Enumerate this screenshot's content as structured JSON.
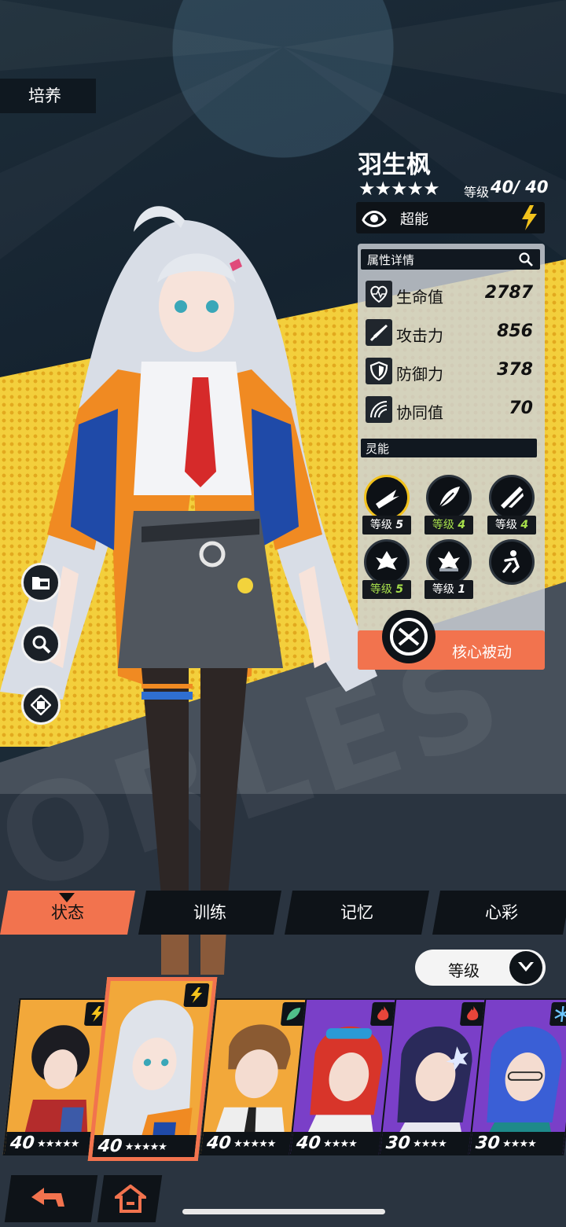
{
  "header": {
    "tag": "培养"
  },
  "character": {
    "name": "羽生枫",
    "stars": "★★★★★",
    "level_label": "等级",
    "level_value": "40/ 40",
    "type": {
      "icon": "esper-eye-icon",
      "label": "超能",
      "element_icon": "lightning-bolt-icon"
    }
  },
  "attributes": {
    "title": "属性详情",
    "stats": [
      {
        "icon": "heart-pulse-icon",
        "label": "生命值",
        "value": "2787"
      },
      {
        "icon": "sword-icon",
        "label": "攻击力",
        "value": "856"
      },
      {
        "icon": "shield-icon",
        "label": "防御力",
        "value": "378"
      },
      {
        "icon": "sync-wave-icon",
        "label": "协同值",
        "value": "70"
      }
    ]
  },
  "psi": {
    "title": "灵能",
    "skills": [
      {
        "icon": "burst-skill-icon",
        "label": "等级",
        "level": "5",
        "highlight": false
      },
      {
        "icon": "feather-skill-icon",
        "label": "等级",
        "level": "4",
        "highlight": true
      },
      {
        "icon": "slash-skill-icon",
        "label": "等级",
        "level": "4",
        "highlight": false
      },
      {
        "icon": "leaf-skill-icon",
        "label": "等级",
        "level": "5",
        "highlight": true
      },
      {
        "icon": "leaf-spark-skill-icon",
        "label": "等级",
        "level": "1",
        "highlight": false
      },
      {
        "icon": "dash-skill-icon",
        "label": "",
        "level": "",
        "highlight": false
      }
    ],
    "core_passive": "核心被动"
  },
  "side_buttons": [
    "folder-icon",
    "magnify-icon",
    "badge-two-icon"
  ],
  "tabs": [
    {
      "label": "状态",
      "active": true
    },
    {
      "label": "训练",
      "active": false
    },
    {
      "label": "记忆",
      "active": false
    },
    {
      "label": "心彩",
      "active": false
    }
  ],
  "sort": {
    "label": "等级"
  },
  "roster": [
    {
      "level": "40",
      "stars": "★★★★★",
      "element": "lightning-bolt-icon",
      "selected": false,
      "color": "#f2a83a"
    },
    {
      "level": "40",
      "stars": "★★★★★",
      "element": "lightning-bolt-icon",
      "selected": true,
      "color": "#f2a83a"
    },
    {
      "level": "40",
      "stars": "★★★★★",
      "element": "leaf-icon",
      "selected": false,
      "color": "#f2a83a"
    },
    {
      "level": "40",
      "stars": "★★★★",
      "element": "flame-icon",
      "selected": false,
      "color": "#7a3fc8"
    },
    {
      "level": "30",
      "stars": "★★★★",
      "element": "flame-icon",
      "selected": false,
      "color": "#7a3fc8"
    },
    {
      "level": "30",
      "stars": "★★★★",
      "element": "snowflake-icon",
      "selected": false,
      "color": "#7a3fc8"
    }
  ],
  "nav": [
    "back-icon",
    "home-icon"
  ],
  "colors": {
    "accent": "#f2734e",
    "yellow": "#f3cf3c",
    "dark": "#0e1318",
    "skill_green": "#a7e04b"
  }
}
